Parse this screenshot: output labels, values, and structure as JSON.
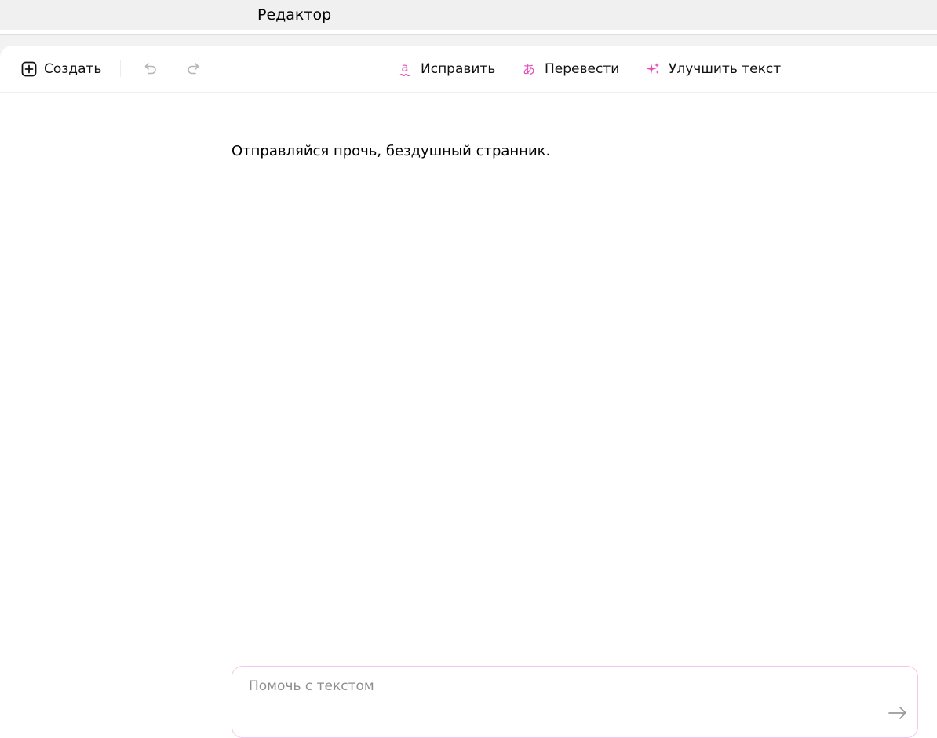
{
  "window": {
    "title": "Редактор"
  },
  "toolbar": {
    "create_label": "Создать",
    "undo_icon": "undo-icon",
    "redo_icon": "redo-icon",
    "fix_label": "Исправить",
    "translate_label": "Перевести",
    "improve_label": "Улучшить текст"
  },
  "document": {
    "text": "Отправляйся прочь, бездушный странник."
  },
  "helper": {
    "placeholder": "Помочь с текстом",
    "value": ""
  },
  "colors": {
    "accent": "#e84cb8",
    "helper_border": "#f3c6ec",
    "topbar_bg": "#f0f0f0"
  }
}
